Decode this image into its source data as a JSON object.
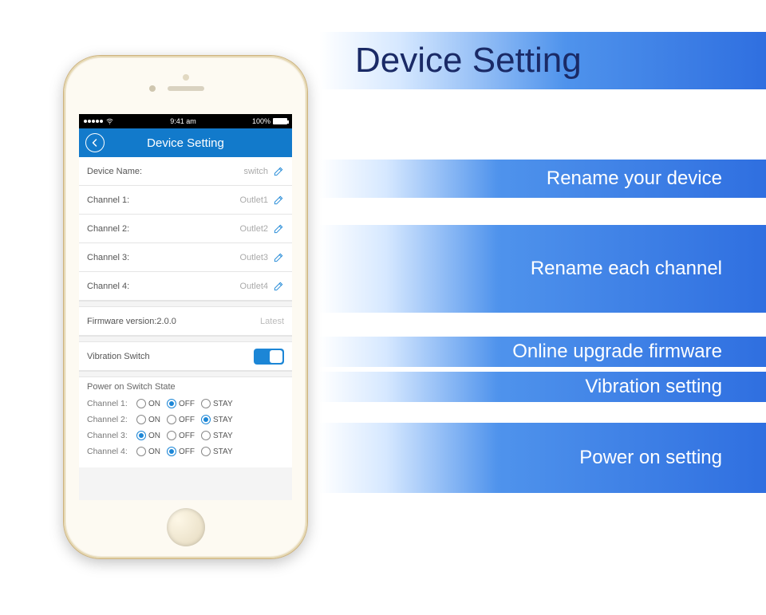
{
  "banner_title": "Device Setting",
  "info_bars": {
    "rename_device": "Rename your device",
    "rename_channel": "Rename each channel",
    "upgrade_firmware": "Online upgrade firmware",
    "vibration_setting": "Vibration setting",
    "power_on_setting": "Power on setting"
  },
  "status_bar": {
    "time": "9:41 am",
    "battery_text": "100%"
  },
  "app_header": {
    "title": "Device Setting"
  },
  "rows": {
    "device_name_label": "Device Name:",
    "device_name_value": "switch",
    "channel1_label": "Channel 1:",
    "channel1_value": "Outlet1",
    "channel2_label": "Channel 2:",
    "channel2_value": "Outlet2",
    "channel3_label": "Channel 3:",
    "channel3_value": "Outlet3",
    "channel4_label": "Channel 4:",
    "channel4_value": "Outlet4",
    "firmware_label": "Firmware version:2.0.0",
    "firmware_value": "Latest",
    "vibration_label": "Vibration Switch"
  },
  "power": {
    "title": "Power on Switch State",
    "labels": {
      "on": "ON",
      "off": "OFF",
      "stay": "STAY"
    },
    "channels": [
      {
        "label": "Channel 1:",
        "selected": "off"
      },
      {
        "label": "Channel 2:",
        "selected": "stay"
      },
      {
        "label": "Channel 3:",
        "selected": "on"
      },
      {
        "label": "Channel 4:",
        "selected": "off"
      }
    ]
  }
}
